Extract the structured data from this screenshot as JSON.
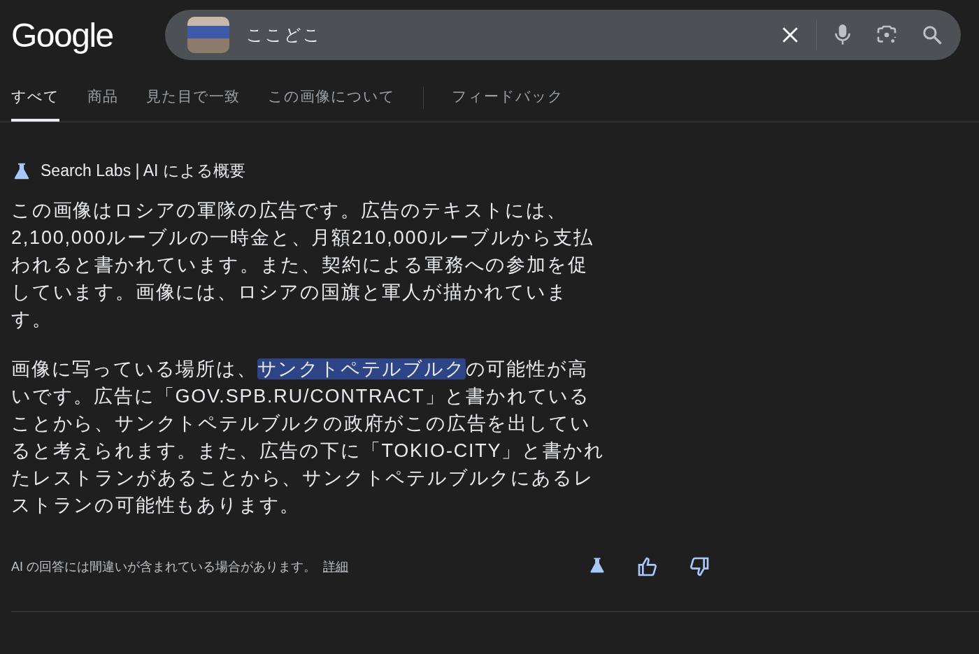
{
  "logo": "Google",
  "search": {
    "value": "ここどこ"
  },
  "tabs": [
    {
      "label": "すべて",
      "selected": true
    },
    {
      "label": "商品",
      "selected": false
    },
    {
      "label": "見た目で一致",
      "selected": false
    },
    {
      "label": "この画像について",
      "selected": false
    },
    {
      "label": "フィードバック",
      "selected": false
    }
  ],
  "overview": {
    "header": "Search Labs | AI による概要",
    "paragraphs": [
      [
        {
          "text": "この画像はロシアの軍隊の広告です。広告のテキストには、2,100,000ルーブルの一時金と、月額210,000ルーブルから支払われると書かれています。また、契約による軍務への参加を促しています。画像には、ロシアの国旗と軍人が描かれています。",
          "highlighted": false
        }
      ],
      [
        {
          "text": "画像に写っている場所は、",
          "highlighted": false
        },
        {
          "text": "サンクトペテルブルク",
          "highlighted": true
        },
        {
          "text": "の可能性が高いです。広告に「GOV.SPB.RU/CONTRACT」と書かれていることから、サンクトペテルブルクの政府がこの広告を出していると考えられます。また、広告の下に「TOKIO-CITY」と書かれたレストランがあることから、サンクトペテルブルクにあるレストランの可能性もあります。",
          "highlighted": false
        }
      ]
    ],
    "disclaimer": "AI の回答には間違いが含まれている場合があります。",
    "details_link": "詳細"
  }
}
